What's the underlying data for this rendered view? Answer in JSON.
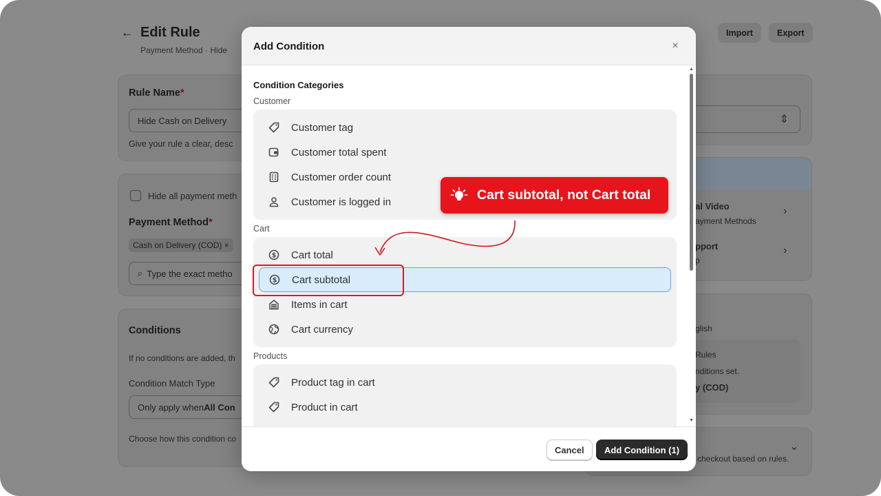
{
  "page": {
    "title": "Edit Rule",
    "subtitle": "Payment Method · Hide",
    "import_label": "Import",
    "export_label": "Export",
    "rule_name_label": "Rule Name",
    "required_mark": "*",
    "rule_name_value": "Hide Cash on Delivery",
    "rule_name_help": "Give your rule a clear, desc",
    "hide_all_label": "Hide all payment meth",
    "payment_method_label": "Payment Method",
    "payment_chip": "Cash on Delivery (COD)",
    "chip_close": "×",
    "payment_search_placeholder": "Type the exact metho",
    "conditions_label": "Conditions",
    "conditions_help": "If no conditions are added, th",
    "match_type_label": "Condition Match Type",
    "match_type_prefix": "Only apply when ",
    "match_type_bold": "All Con",
    "match_type_help": "Choose how this condition co",
    "right_video_title": "al Video",
    "right_video_sub": "ayment Methods",
    "right_support_title": "pport",
    "right_support_sub": "p",
    "right_lang": "glish",
    "right_rules": "Rules",
    "right_rules_sub": "nditions set.",
    "right_cod": "y (COD)",
    "right_checkout": "checkout based on rules."
  },
  "modal": {
    "title": "Add Condition",
    "close_icon": "×",
    "section_title": "Condition Categories",
    "groups": [
      {
        "label": "Customer",
        "items": [
          {
            "label": "Customer tag",
            "icon": "tag-icon"
          },
          {
            "label": "Customer total spent",
            "icon": "wallet-icon"
          },
          {
            "label": "Customer order count",
            "icon": "receipt-icon"
          },
          {
            "label": "Customer is logged in",
            "icon": "person-icon"
          }
        ]
      },
      {
        "label": "Cart",
        "items": [
          {
            "label": "Cart total",
            "icon": "dollar-circle-icon"
          },
          {
            "label": "Cart subtotal",
            "icon": "dollar-circle-icon",
            "selected": true
          },
          {
            "label": "Items in cart",
            "icon": "cart-items-icon"
          },
          {
            "label": "Cart currency",
            "icon": "globe-icon"
          }
        ]
      },
      {
        "label": "Products",
        "items": [
          {
            "label": "Product tag in cart",
            "icon": "tag-icon"
          },
          {
            "label": "Product in cart",
            "icon": "tag-icon"
          }
        ]
      }
    ],
    "cancel_label": "Cancel",
    "add_label": "Add Condition (1)"
  },
  "annotation": {
    "text": "Cart subtotal, not Cart total",
    "color": "#e8141b"
  },
  "colors": {
    "selected_bg": "#d8ecfc",
    "selected_border": "#6ea3d8",
    "primary_button": "#2b2b2b"
  }
}
